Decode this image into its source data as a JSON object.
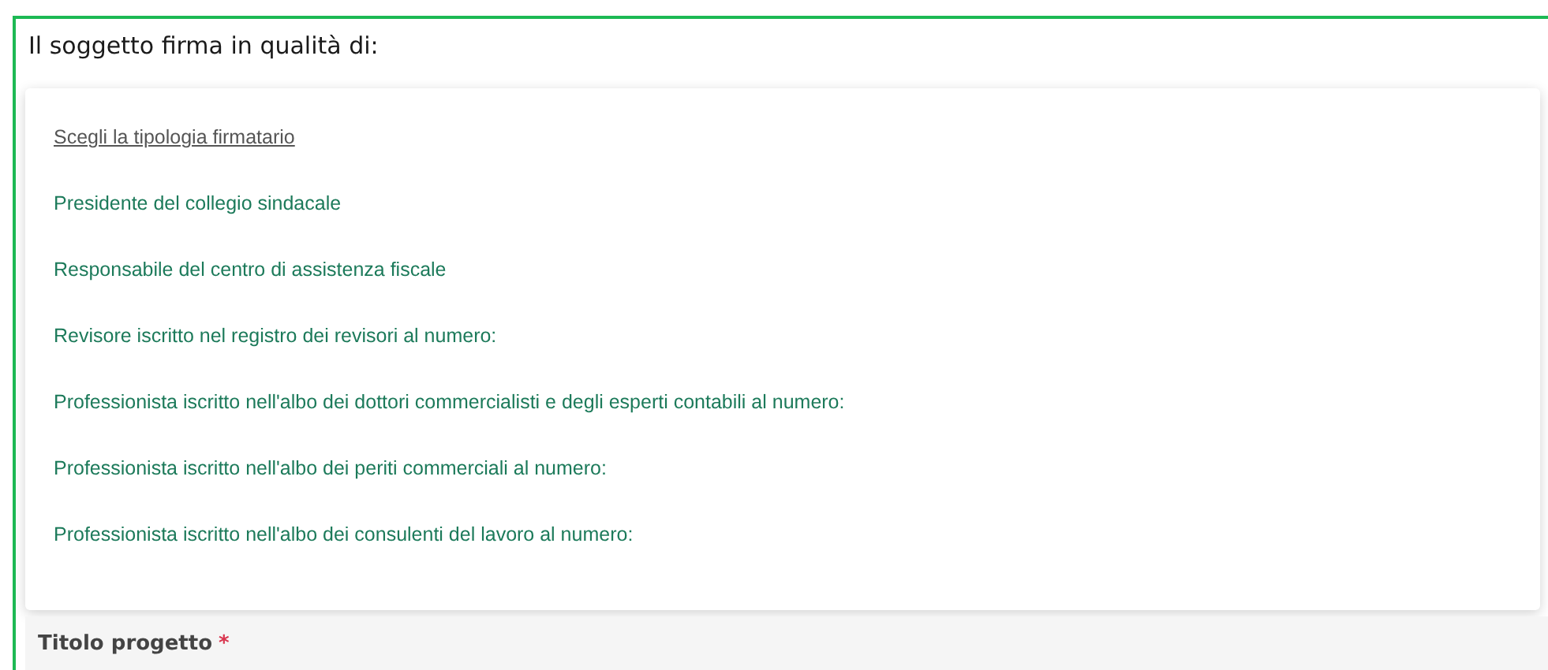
{
  "section": {
    "heading": "Il soggetto firma in qualità di:"
  },
  "dropdown": {
    "options": [
      {
        "label": "Scegli la tipologia firmatario",
        "kind": "placeholder"
      },
      {
        "label": "Presidente del collegio sindacale",
        "kind": "option"
      },
      {
        "label": "Responsabile del centro di assistenza fiscale",
        "kind": "option"
      },
      {
        "label": "Revisore iscritto nel registro dei revisori al numero:",
        "kind": "option"
      },
      {
        "label": "Professionista iscritto nell'albo dei dottori commercialisti e degli esperti contabili al numero:",
        "kind": "option"
      },
      {
        "label": "Professionista iscritto nell'albo dei periti commerciali al numero:",
        "kind": "option"
      },
      {
        "label": "Professionista iscritto nell'albo dei consulenti del lavoro al numero:",
        "kind": "option"
      }
    ]
  },
  "field": {
    "label": "Titolo progetto",
    "required_mark": "*"
  }
}
